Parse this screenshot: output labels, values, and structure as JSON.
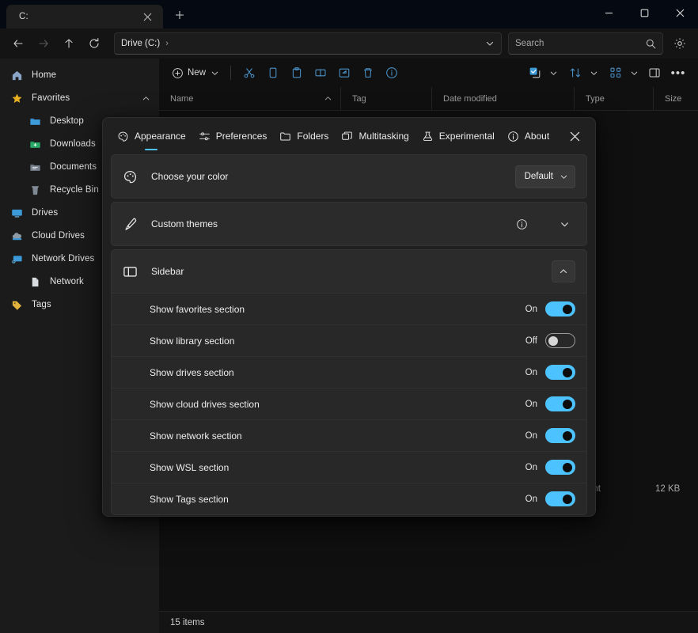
{
  "window": {
    "tab": {
      "label": "C:",
      "close_icon": "close-icon"
    },
    "new_tab_icon": "plus-icon",
    "controls": {
      "minimize": "─",
      "maximize": "□",
      "close": "✕"
    }
  },
  "navbar": {
    "back_icon": "arrow-left-icon",
    "forward_icon": "arrow-right-icon",
    "up_icon": "arrow-up-icon",
    "refresh_icon": "refresh-icon",
    "breadcrumb": "Drive (C:)",
    "breadcrumb_sep": "›",
    "address_caret_icon": "chevron-down-icon",
    "search_placeholder": "Search",
    "search_value": "",
    "search_icon": "search-icon",
    "settings_icon": "gear-icon"
  },
  "sidebar": {
    "items": [
      {
        "label": "Home",
        "icon": "home-icon",
        "indent": false,
        "chevron": ""
      },
      {
        "label": "Favorites",
        "icon": "star-icon",
        "indent": false,
        "chevron": "chevron-up-icon"
      },
      {
        "label": "Desktop",
        "icon": "folder-desktop-icon",
        "indent": true,
        "chevron": ""
      },
      {
        "label": "Downloads",
        "icon": "folder-downloads-icon",
        "indent": true,
        "chevron": ""
      },
      {
        "label": "Documents",
        "icon": "folder-documents-icon",
        "indent": true,
        "chevron": ""
      },
      {
        "label": "Recycle Bin",
        "icon": "recycle-bin-icon",
        "indent": true,
        "chevron": ""
      },
      {
        "label": "Drives",
        "icon": "drive-icon",
        "indent": false,
        "chevron": ""
      },
      {
        "label": "Cloud Drives",
        "icon": "cloud-drive-icon",
        "indent": false,
        "chevron": ""
      },
      {
        "label": "Network Drives",
        "icon": "network-drive-icon",
        "indent": false,
        "chevron": ""
      },
      {
        "label": "Network",
        "icon": "network-file-icon",
        "indent": true,
        "chevron": ""
      },
      {
        "label": "Tags",
        "icon": "tag-icon",
        "indent": false,
        "chevron": ""
      }
    ]
  },
  "toolbar": {
    "new_label": "New",
    "new_icon": "plus-circle-icon",
    "new_caret_icon": "chevron-down-icon",
    "actions": [
      {
        "name": "cut-button",
        "icon": "scissors-icon"
      },
      {
        "name": "copy-button",
        "icon": "copy-icon"
      },
      {
        "name": "paste-button",
        "icon": "paste-icon"
      },
      {
        "name": "rename-button",
        "icon": "rename-icon"
      },
      {
        "name": "share-button",
        "icon": "share-icon"
      },
      {
        "name": "delete-button",
        "icon": "trash-icon"
      },
      {
        "name": "properties-button",
        "icon": "info-circle-icon"
      }
    ],
    "right": [
      {
        "name": "selection-button",
        "icon": "checkbox-select-icon",
        "caret": true
      },
      {
        "name": "sort-button",
        "icon": "sort-icon",
        "caret": true
      },
      {
        "name": "layout-button",
        "icon": "layout-grid-icon",
        "caret": true
      },
      {
        "name": "preview-pane-button",
        "icon": "preview-pane-icon",
        "caret": false
      }
    ],
    "overflow_label": "•••"
  },
  "columns": [
    {
      "label": "Name",
      "sort_icon": "chevron-up-icon"
    },
    {
      "label": "Tag",
      "sort_icon": ""
    },
    {
      "label": "Date modified",
      "sort_icon": ""
    },
    {
      "label": "Type",
      "sort_icon": ""
    },
    {
      "label": "Size",
      "sort_icon": ""
    }
  ],
  "files": [
    {
      "type": "ument",
      "size": "12 KB"
    }
  ],
  "statusbar": {
    "items_text": "15 items"
  },
  "dialog": {
    "tabs": [
      {
        "label": "Appearance",
        "icon": "palette-icon",
        "active": true
      },
      {
        "label": "Preferences",
        "icon": "sliders-icon",
        "active": false
      },
      {
        "label": "Folders",
        "icon": "folder-icon",
        "active": false
      },
      {
        "label": "Multitasking",
        "icon": "multitasking-icon",
        "active": false
      },
      {
        "label": "Experimental",
        "icon": "flask-icon",
        "active": false
      },
      {
        "label": "About",
        "icon": "info-circle-icon",
        "active": false
      }
    ],
    "close_icon": "close-icon",
    "cards": [
      {
        "name": "choose-your-color",
        "label": "Choose your color",
        "icon": "palette-icon",
        "control": "dropdown",
        "value": "Default",
        "caret_icon": "chevron-down-icon"
      },
      {
        "name": "custom-themes",
        "label": "Custom themes",
        "icon": "brush-icon",
        "control": "info-expand",
        "info_icon": "info-circle-icon",
        "caret_icon": "chevron-down-icon"
      }
    ],
    "section": {
      "name": "sidebar-section",
      "label": "Sidebar",
      "icon": "sidebar-icon",
      "expander_icon": "chevron-up-icon",
      "rows": [
        {
          "label": "Show favorites section",
          "state": "On",
          "on": true
        },
        {
          "label": "Show library section",
          "state": "Off",
          "on": false
        },
        {
          "label": "Show drives section",
          "state": "On",
          "on": true
        },
        {
          "label": "Show cloud drives section",
          "state": "On",
          "on": true
        },
        {
          "label": "Show network section",
          "state": "On",
          "on": true
        },
        {
          "label": "Show WSL section",
          "state": "On",
          "on": true
        },
        {
          "label": "Show Tags section",
          "state": "On",
          "on": true
        }
      ]
    }
  },
  "colors": {
    "accent": "#4cc2ff",
    "dialog_bg": "#202020",
    "card_bg": "#2b2b2b",
    "sidebar_bg": "#1b1b1b",
    "content_bg": "#101010",
    "toolbar_icon": "#4a93c9"
  }
}
